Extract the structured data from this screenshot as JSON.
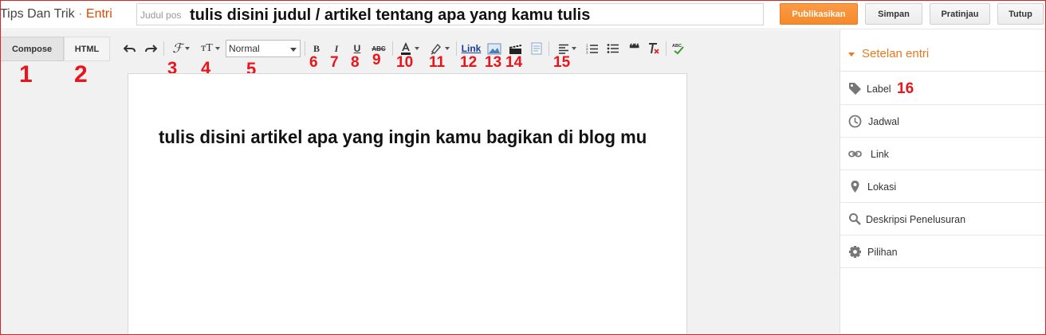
{
  "header": {
    "blog_name": "Tips Dan Trik",
    "separator": "·",
    "section": "Entri",
    "title_placeholder": "Judul pos",
    "title_value": "tulis disini judul / artikel tentang apa yang kamu tulis",
    "buttons": {
      "publish": "Publikasikan",
      "save": "Simpan",
      "preview": "Pratinjau",
      "close": "Tutup"
    },
    "colors": {
      "accent": "#dd4b00",
      "publish": "#f58a2a"
    }
  },
  "mode_tabs": {
    "compose": "Compose",
    "html": "HTML"
  },
  "toolbar": {
    "format_value": "Normal",
    "link_label": "Link",
    "font_icon_glyph": "ℱ",
    "size_icon_glyph": "тT",
    "bold_glyph": "B",
    "italic_glyph": "I",
    "underline_glyph": "U",
    "strike_glyph": "ABC",
    "spell_glyph": "ABC",
    "quote_glyph": "❝❝",
    "clear_glyph": "T",
    "icons": [
      "undo-icon",
      "redo-icon",
      "font-icon",
      "font-size-icon",
      "bold-icon",
      "italic-icon",
      "underline-icon",
      "strikethrough-icon",
      "text-color-icon",
      "highlight-icon",
      "link-icon",
      "image-icon",
      "video-icon",
      "jump-break-icon",
      "align-icon",
      "numbered-list-icon",
      "bullet-list-icon",
      "quote-icon",
      "clear-format-icon",
      "spellcheck-icon"
    ]
  },
  "annotations": {
    "n1": "1",
    "n2": "2",
    "n3": "3",
    "n4": "4",
    "n5": "5",
    "n6": "6",
    "n7": "7",
    "n8": "8",
    "n9": "9",
    "n10": "10",
    "n11": "11",
    "n12": "12",
    "n13": "13",
    "n14": "14",
    "n15": "15",
    "n16": "16",
    "color": "#e8151b"
  },
  "editor": {
    "content": "tulis disini artikel apa yang ingin kamu bagikan di blog mu"
  },
  "sidebar": {
    "title": "Setelan entri",
    "items": [
      {
        "label": "Label",
        "icon": "tag-icon"
      },
      {
        "label": "Jadwal",
        "icon": "clock-icon"
      },
      {
        "label": "Link",
        "icon": "link-icon"
      },
      {
        "label": "Lokasi",
        "icon": "location-pin-icon"
      },
      {
        "label": "Deskripsi Penelusuran",
        "icon": "search-icon"
      },
      {
        "label": "Pilihan",
        "icon": "gear-icon"
      }
    ]
  }
}
